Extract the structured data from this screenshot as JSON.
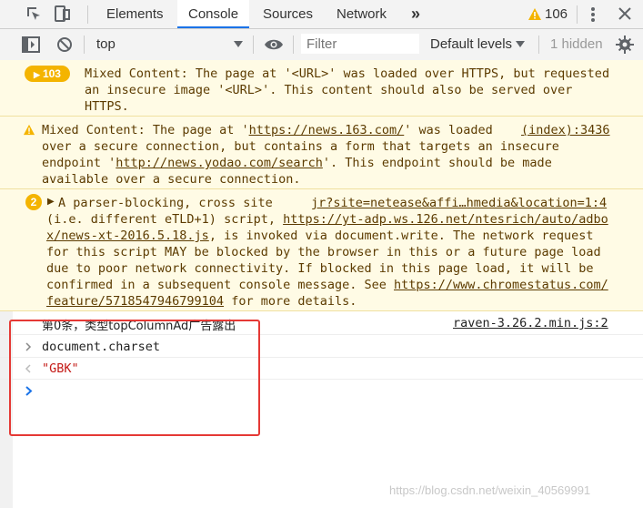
{
  "tabs": {
    "elements": "Elements",
    "console": "Console",
    "sources": "Sources",
    "network": "Network",
    "more": "»",
    "warning_count": "106"
  },
  "toolbar": {
    "context": "top",
    "filter_placeholder": "Filter",
    "levels": "Default levels",
    "hidden": "1 hidden"
  },
  "messages": {
    "m1": {
      "badge": "103",
      "line1": "Mixed Content: The page at '<URL>' was loaded over HTTPS, but requested",
      "line2": "an insecure image '<URL>'. This content should also be served over",
      "line3": "HTTPS."
    },
    "m2": {
      "line1a": "Mixed Content: The page at '",
      "link1": "https://news.163.com/",
      "line1b": "' was loaded",
      "source": "(index):3436",
      "line2": "over a secure connection, but contains a form that targets an insecure",
      "line3a": "endpoint '",
      "link2": "http://news.yodao.com/search",
      "line3b": "'. This endpoint should be made",
      "line4": "available over a secure connection."
    },
    "m3": {
      "badge": "2",
      "line1": "A parser-blocking, cross site",
      "source": "jr?site=netease&affi…hmedia&location=1:4",
      "line2a": "(i.e. different eTLD+1) script, ",
      "link1a": "https://yt-adp.ws.126.net/ntesrich/auto/adbo",
      "link1b": "x/news-xt-2016.5.18.js",
      "line3b": ", is invoked via document.write. The network request",
      "line4": "for this script MAY be blocked by the browser in this or a future page load",
      "line5": "due to poor network connectivity. If blocked in this page load, it will be",
      "line6a": "confirmed in a subsequent console message. See ",
      "link2a": "https://www.chromestatus.com/",
      "link2b": "feature/5718547946799104",
      "line7b": " for more details."
    },
    "m4": {
      "text": "第0条，类型topColumnAd广告露出",
      "source": "raven-3.26.2.min.js:2"
    },
    "input": "document.charset",
    "output": "\"GBK\""
  },
  "watermark": "https://blog.csdn.net/weixin_40569991",
  "colors": {
    "warn_bg": "#fffbe5",
    "warn_text": "#5c3b00",
    "badge": "#f4b400",
    "string_value": "#c41a16",
    "prompt": "#1a73e8",
    "highlight_box": "#e53935"
  }
}
